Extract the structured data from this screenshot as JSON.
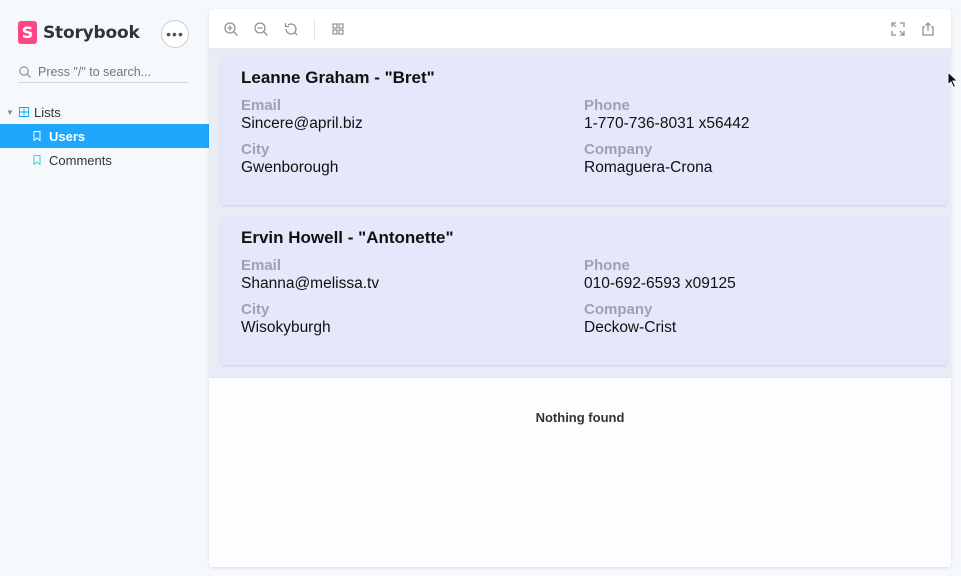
{
  "app": {
    "name": "Storybook",
    "logo_letter": "S",
    "menu_glyph": "•••"
  },
  "search": {
    "placeholder": "Press \"/\" to search..."
  },
  "tree": {
    "group": {
      "label": "Lists"
    },
    "items": [
      {
        "label": "Users",
        "active": true
      },
      {
        "label": "Comments",
        "active": false
      }
    ]
  },
  "toolbar": {
    "left_icons": [
      "zoom-in-icon",
      "zoom-out-icon",
      "zoom-reset-icon",
      "grid-icon"
    ],
    "right_icons": [
      "fullscreen-icon",
      "share-icon"
    ]
  },
  "users": [
    {
      "title": "Leanne Graham - \"Bret\"",
      "email_label": "Email",
      "email": "Sincere@april.biz",
      "phone_label": "Phone",
      "phone": "1-770-736-8031 x56442",
      "city_label": "City",
      "city": "Gwenborough",
      "company_label": "Company",
      "company": "Romaguera-Crona"
    },
    {
      "title": "Ervin Howell - \"Antonette\"",
      "email_label": "Email",
      "email": "Shanna@melissa.tv",
      "phone_label": "Phone",
      "phone": "010-692-6593 x09125",
      "city_label": "City",
      "city": "Wisokyburgh",
      "company_label": "Company",
      "company": "Deckow-Crist"
    }
  ],
  "empty_state": {
    "text": "Nothing found"
  },
  "colors": {
    "accent": "#1ea7fd",
    "brand": "#ff4785",
    "card_bg": "#e5e7fb",
    "label": "#9ba3b3"
  }
}
